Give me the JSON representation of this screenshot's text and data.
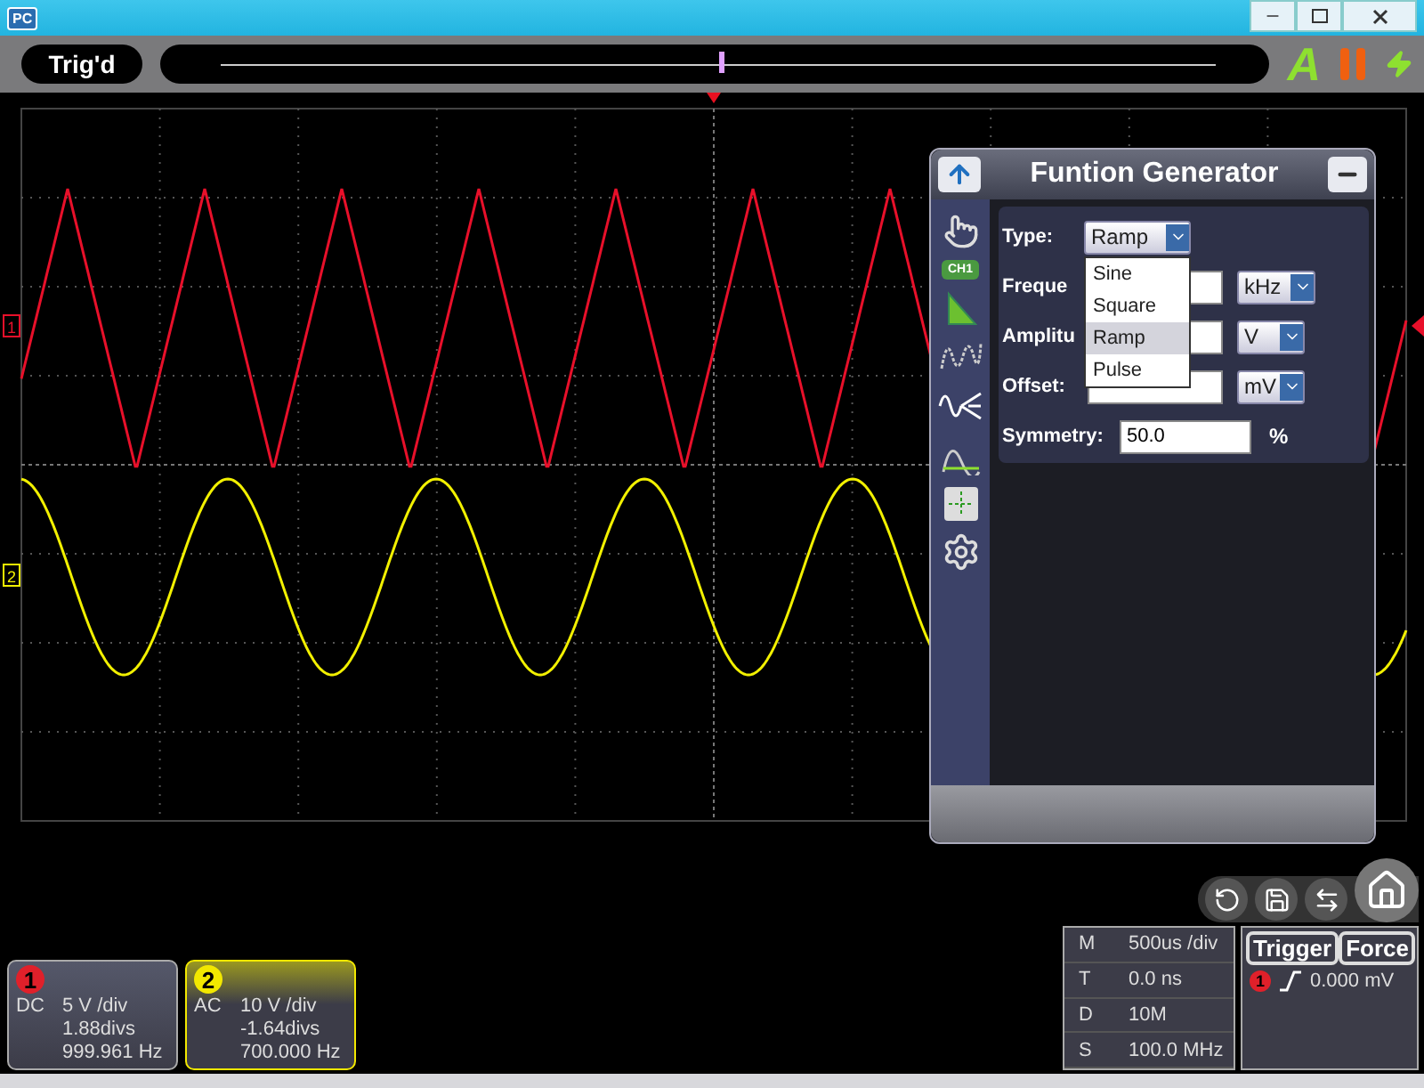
{
  "app_icon": "PC",
  "toolbar": {
    "status": "Trig'd",
    "auto_label": "A"
  },
  "screen": {
    "channels": [
      {
        "label": "1",
        "color": "#e8102a",
        "kind": "triangle"
      },
      {
        "label": "2",
        "color": "#f2f000",
        "kind": "sine"
      }
    ]
  },
  "function_generator": {
    "title": "Funtion Generator",
    "badge": "CH1",
    "type": {
      "label": "Type:",
      "value": "Ramp",
      "options": [
        {
          "label": "Sine",
          "selected": false
        },
        {
          "label": "Square",
          "selected": false
        },
        {
          "label": "Ramp",
          "selected": true
        },
        {
          "label": "Pulse",
          "selected": false
        }
      ]
    },
    "fields": [
      {
        "label": "Freque",
        "unit": "kHz"
      },
      {
        "label": "Amplitu",
        "unit": "V"
      },
      {
        "label": "Offset:",
        "unit": "mV"
      },
      {
        "label": "Symmetry:",
        "value": "50.0",
        "suffix": "%"
      }
    ]
  },
  "channel_cards": [
    {
      "number": "1",
      "coupling": "DC",
      "scale": "5 V /div",
      "offset": "1.88divs",
      "frequency": "999.961 Hz",
      "color": "#e0202a",
      "selected": false
    },
    {
      "number": "2",
      "coupling": "AC",
      "scale": "10 V /div",
      "offset": "-1.64divs",
      "frequency": "700.000 Hz",
      "color": "#f2e800",
      "selected": true
    }
  ],
  "timebase": [
    {
      "key": "M",
      "value": "500us /div"
    },
    {
      "key": "T",
      "value": "0.0 ns"
    },
    {
      "key": "D",
      "value": "10M"
    },
    {
      "key": "S",
      "value": "100.0 MHz"
    }
  ],
  "trigger": {
    "buttons": [
      "Trigger",
      "Force"
    ],
    "source": "1",
    "level": "0.000 mV"
  }
}
